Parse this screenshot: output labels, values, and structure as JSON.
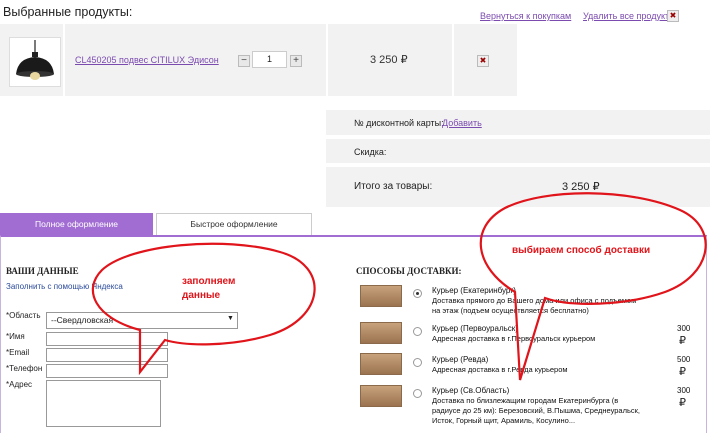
{
  "header": {
    "title": "Выбранные продукты:",
    "back_link": "Вернуться к покупкам",
    "remove_all": "Удалить все продукты",
    "remove_all_icon": "x-icon"
  },
  "product": {
    "name": "CL450205 подвес CITILUX Эдисон",
    "minus": "−",
    "quantity": "1",
    "plus": "+",
    "price": "3 250 ₽",
    "remove_icon": "x-icon"
  },
  "summary": {
    "card_label": "№ дисконтной карты:",
    "card_link": "Добавить",
    "discount_label": "Скидка:",
    "total_label": "Итого за товары:",
    "total_value": "3 250 ₽"
  },
  "tabs": [
    {
      "label": "Полное оформление",
      "active": true
    },
    {
      "label": "Быстрое оформление",
      "active": false
    }
  ],
  "user_data": {
    "title": "ВАШИ ДАННЫЕ",
    "yandex_link": "Заполнить с помощью Яндекса",
    "region_label": "*Область",
    "region_value": "--Свердловская",
    "name_label": "*Имя",
    "email_label": "*Email",
    "phone_label": "*Телефон",
    "address_label": "*Адрес"
  },
  "shipping": {
    "title": "СПОСОБЫ ДОСТАВКИ:",
    "options": [
      {
        "name": "Курьер (Екатеринбург)",
        "desc1": "Доставка прямого до Вашего дома или офиса с подъемом",
        "desc2": "на этаж (подъем осуществляется бесплатно)",
        "price": "",
        "rub": "",
        "selected": true
      },
      {
        "name": "Курьер (Первоуральск)",
        "desc1": "Адресная доставка в г.Первоуральск курьером",
        "desc2": "",
        "price": "300",
        "rub": "₽",
        "selected": false
      },
      {
        "name": "Курьер (Ревда)",
        "desc1": "Адресная доставка в г.Ревда курьером",
        "desc2": "",
        "price": "500",
        "rub": "₽",
        "selected": false
      },
      {
        "name": "Курьер (Св.Область)",
        "desc1": "Доставка по близлежащим городам Екатеринбурга (в",
        "desc2": "радиусе до 25 км): Березовский, В.Пышма, Среднеуральск,",
        "desc3": "Исток, Горный щит, Арамиль, Косулино...",
        "price": "300",
        "rub": "₽",
        "selected": false
      }
    ]
  },
  "annotations": {
    "left_line1": "заполняем",
    "left_line2": "данные",
    "right": "выбираем способ доставки"
  },
  "colors": {
    "accent": "#a26dd3",
    "link": "#7b4bb0",
    "annotation": "#e0141a"
  }
}
